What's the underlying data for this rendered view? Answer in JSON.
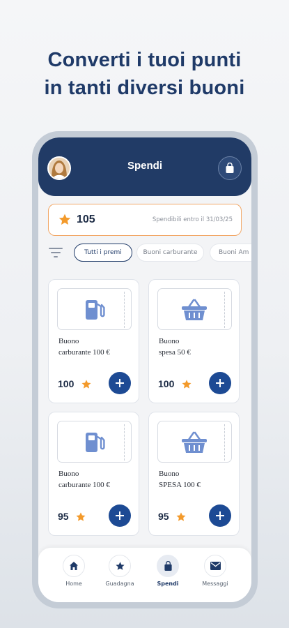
{
  "headline": {
    "line1": "Converti i tuoi punti",
    "line2": "in tanti diversi buoni"
  },
  "appbar": {
    "title": "Spendi",
    "avatar_icon": "user-avatar",
    "action_icon": "shopping-bag-icon"
  },
  "points": {
    "value": "105",
    "expiry_text": "Spendibili entro il 31/03/25",
    "icon": "star-icon"
  },
  "filters": {
    "icon": "filter-icon",
    "chips": [
      "Tutti i premi",
      "Buoni carburante",
      "Buoni Am"
    ],
    "selected": "Tutti i premi"
  },
  "rewards": [
    {
      "title_line1": "Buono",
      "title_line2": "carburante 100 €",
      "price": "100",
      "icon": "fuel-pump-icon"
    },
    {
      "title_line1": "Buono",
      "title_line2": "spesa 50 €",
      "price": "100",
      "icon": "shopping-basket-icon"
    },
    {
      "title_line1": "Buono",
      "title_line2": "carburante 100 €",
      "price": "95",
      "icon": "fuel-pump-icon"
    },
    {
      "title_line1": "Buono",
      "title_line2": "SPESA 100 €",
      "price": "95",
      "icon": "shopping-basket-icon"
    }
  ],
  "tabs": [
    {
      "label": "Home",
      "icon": "home-icon"
    },
    {
      "label": "Guadagna",
      "icon": "star-icon"
    },
    {
      "label": "Spendi",
      "icon": "shopping-bag-icon",
      "active": true
    },
    {
      "label": "Messaggi",
      "icon": "mail-icon"
    }
  ],
  "colors": {
    "brand_navy": "#213b66",
    "accent_blue": "#1d4a94",
    "star_orange": "#f39a2b",
    "points_border": "#f2a868",
    "icon_light_blue": "#6f8fd0"
  }
}
